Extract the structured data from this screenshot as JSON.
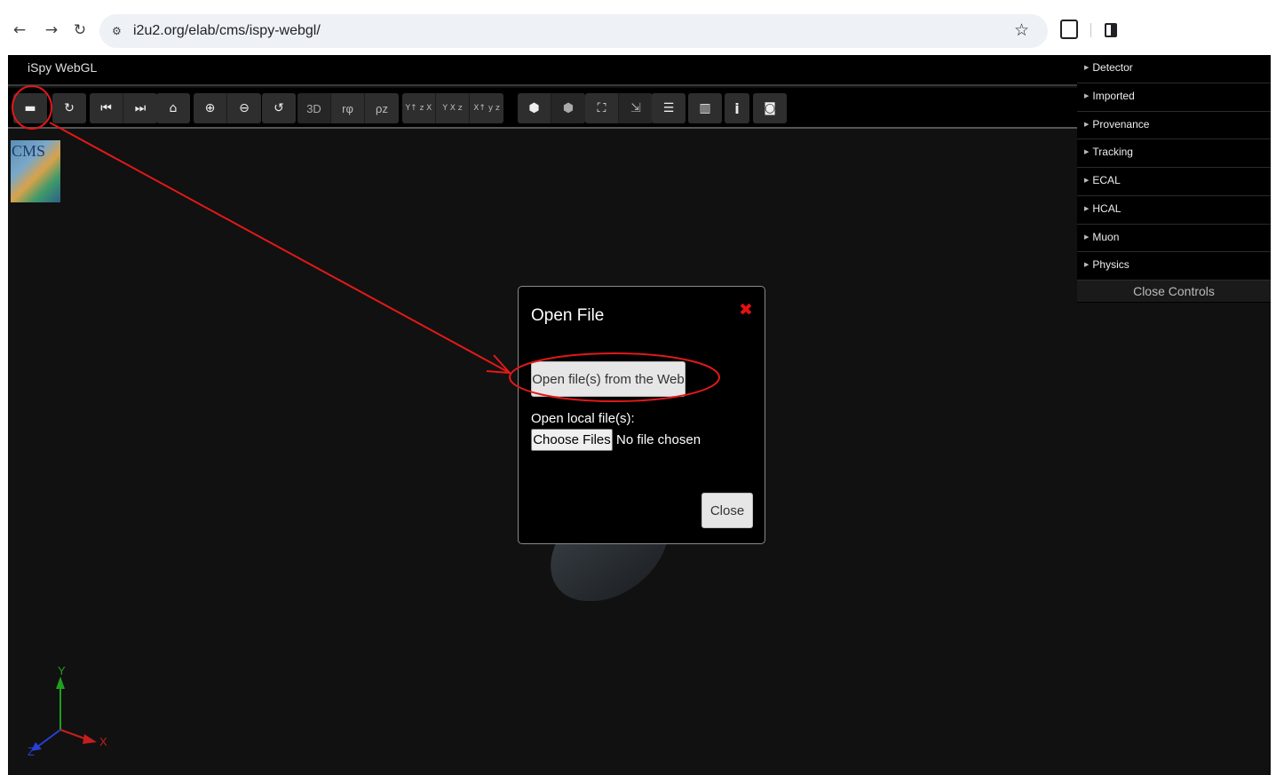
{
  "browser": {
    "back_icon": "←",
    "forward_icon": "→",
    "reload_icon": "↻",
    "site_info_icon": "⚙",
    "url": "i2u2.org/elab/cms/ispy-webgl/",
    "bookmark_icon": "☆"
  },
  "app": {
    "title": "iSpy WebGL",
    "logo_text": "CMS"
  },
  "toolbar": {
    "open": "▬",
    "reload": "↻",
    "prev": "⏮",
    "next": "⏭",
    "home": "⌂",
    "zoom_in": "⊕",
    "zoom_out": "⊖",
    "reset": "↺",
    "view_3d": "3D",
    "view_rphi": "rφ",
    "view_rhoz": "ρz",
    "axes_yx": "Y↑ z X",
    "axes_yz": "Y X z",
    "axes_xz": "X↑ y z",
    "perspective": "⬢",
    "ortho": "⬢",
    "fullscreen": "⛶",
    "exit_fullscreen": "⇲",
    "controls": "☰",
    "chart": "▥",
    "info": "i",
    "camera": "◙"
  },
  "side_panel": {
    "items": [
      "Detector",
      "Imported",
      "Provenance",
      "Tracking",
      "ECAL",
      "HCAL",
      "Muon",
      "Physics"
    ],
    "close_label": "Close Controls"
  },
  "dialog": {
    "title": "Open File",
    "close_x": "✖",
    "open_web_label": "Open file(s) from the Web",
    "local_label": "Open local file(s):",
    "choose_files_label": "Choose Files",
    "no_file_label": "No file chosen",
    "close_label": "Close"
  },
  "axes": {
    "y_label": "Y",
    "x_label": "X",
    "z_label": "Z"
  },
  "colors": {
    "annotation_red": "#e11919",
    "y_axis": "#1fa01f",
    "x_axis": "#c41e1e",
    "z_axis": "#2a3fd8"
  }
}
